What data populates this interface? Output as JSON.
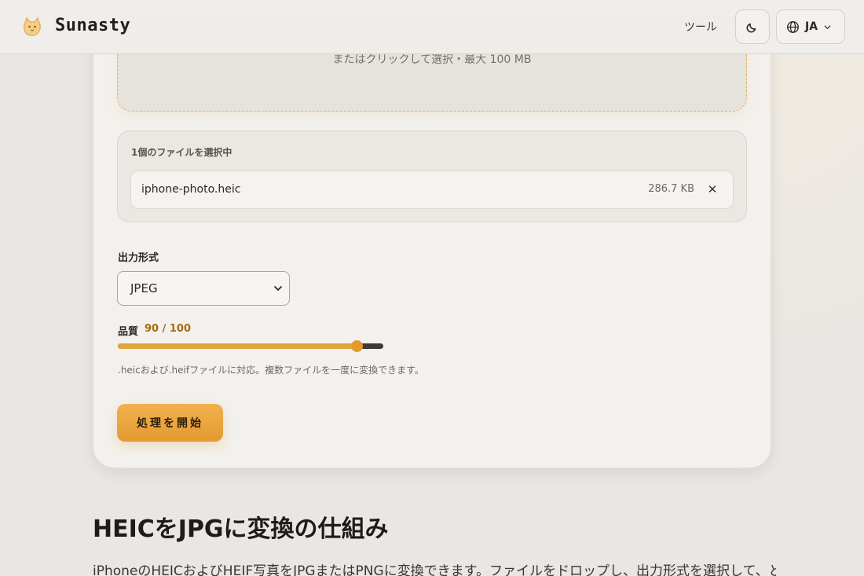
{
  "header": {
    "brand": "Sunasty",
    "nav_tools": "ツール",
    "lang_code": "JA"
  },
  "uploader": {
    "drop_subtext": "またはクリックして選択・最大 100 MB"
  },
  "files": {
    "count_label": "1個のファイルを選択中",
    "items": [
      {
        "name": "iphone-photo.heic",
        "size": "286.7 KB",
        "remove_symbol": "✕"
      }
    ]
  },
  "format": {
    "label": "出力形式",
    "selected": "JPEG"
  },
  "quality": {
    "label": "品質",
    "value_text": "90 / 100",
    "value": 90,
    "max": 100
  },
  "hint": ".heicおよび.heifファイルに対応。複数ファイルを一度に変換できます。",
  "start_button": "処理を開始",
  "section": {
    "title": "HEICをJPGに変換の仕組み",
    "body": "iPhoneのHEICおよびHEIF写真をJPGまたはPNGに変換できます。ファイルをドロップし、出力形式を選択して、ど"
  },
  "colors": {
    "accent": "#e49b30",
    "quality_value": "#a86a14",
    "background": "#e9e7e3"
  },
  "icons": {
    "logo": "cat-logo-icon",
    "theme": "moon-icon",
    "language": "globe-icon",
    "dropdown": "chevron-down-icon"
  }
}
